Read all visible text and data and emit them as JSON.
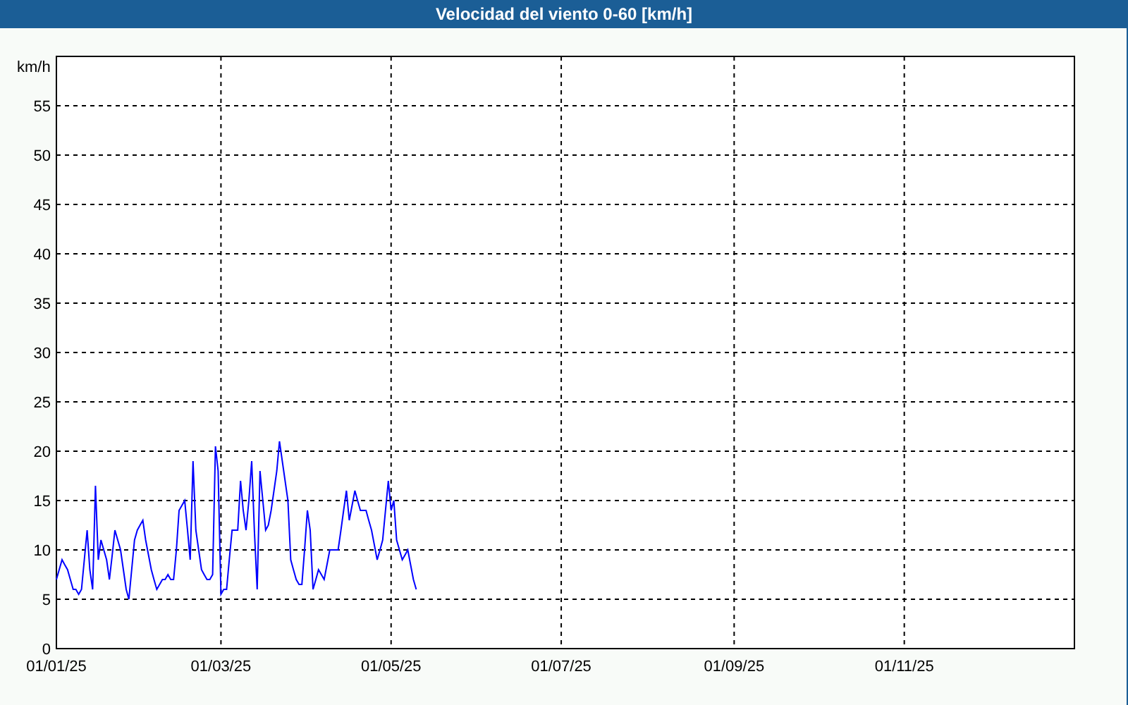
{
  "window": {
    "title": "Velocidad del viento 0-60 [km/h]"
  },
  "chart": {
    "chart_data": {
      "type": "line",
      "ylabel": "km/h",
      "grid": true,
      "ylim": [
        0,
        60
      ],
      "yticks": [
        0,
        5,
        10,
        15,
        20,
        25,
        30,
        35,
        40,
        45,
        50,
        55
      ],
      "categories": [
        "01/01/25",
        null,
        null,
        null,
        null,
        null,
        null,
        null,
        null,
        null,
        null,
        null,
        null,
        null,
        null,
        null,
        null,
        null,
        null,
        null,
        null,
        null,
        null,
        null,
        null,
        null,
        null,
        null,
        null,
        null,
        null,
        null,
        null,
        null,
        null,
        null,
        null,
        null,
        null,
        null,
        null,
        null,
        null,
        null,
        null,
        null,
        null,
        null,
        null,
        null,
        null,
        null,
        null,
        null,
        null,
        null,
        null,
        null,
        null,
        "01/03/25",
        null,
        null,
        null,
        null,
        null,
        null,
        null,
        null,
        null,
        null,
        null,
        null,
        null,
        null,
        null,
        null,
        null,
        null,
        null,
        null,
        null,
        null,
        null,
        null,
        null,
        null,
        null,
        null,
        null,
        null,
        null,
        null,
        null,
        null,
        null,
        null,
        null,
        null,
        null,
        null,
        null,
        null,
        null,
        null,
        null,
        null,
        null,
        null,
        null,
        null,
        null,
        null,
        null,
        null,
        null,
        null,
        null,
        null,
        null,
        null,
        "01/05/25",
        null,
        null,
        null,
        null,
        null,
        null,
        null,
        null,
        null,
        null,
        null,
        null,
        null,
        null,
        null,
        null,
        null,
        null,
        null,
        null,
        null,
        null,
        null,
        null,
        null,
        null,
        null,
        null,
        null,
        null,
        null,
        null,
        null,
        null,
        null,
        null,
        null,
        null,
        null,
        null,
        null,
        null,
        null,
        null,
        null,
        null,
        null,
        null,
        null,
        null,
        null,
        null,
        null,
        null,
        null,
        null,
        null,
        null,
        null,
        null,
        "01/07/25",
        null,
        null,
        null,
        null,
        null,
        null,
        null,
        null,
        null,
        null,
        null,
        null,
        null,
        null,
        null,
        null,
        null,
        null,
        null,
        null,
        null,
        null,
        null,
        null,
        null,
        null,
        null,
        null,
        null,
        null,
        null,
        null,
        null,
        null,
        null,
        null,
        null,
        null,
        null,
        null,
        null,
        null,
        null,
        null,
        null,
        null,
        null,
        null,
        null,
        null,
        null,
        null,
        null,
        null,
        null,
        null,
        null,
        null,
        null,
        null,
        null,
        "01/09/25",
        null,
        null,
        null,
        null,
        null,
        null,
        null,
        null,
        null,
        null,
        null,
        null,
        null,
        null,
        null,
        null,
        null,
        null,
        null,
        null,
        null,
        null,
        null,
        null,
        null,
        null,
        null,
        null,
        null,
        null,
        null,
        null,
        null,
        null,
        null,
        null,
        null,
        null,
        null,
        null,
        null,
        null,
        null,
        null,
        null,
        null,
        null,
        null,
        null,
        null,
        null,
        null,
        null,
        null,
        null,
        null,
        null,
        null,
        null,
        null,
        "01/11/25"
      ],
      "series": [
        {
          "color": "#0000ff",
          "values": [
            7,
            8,
            9,
            8.5,
            8,
            7,
            6,
            6,
            5.5,
            6,
            9,
            12,
            8,
            6,
            16.5,
            9,
            11,
            10,
            9,
            7,
            9.5,
            12,
            11,
            10,
            8,
            6,
            5,
            8,
            11,
            12,
            12.5,
            13,
            11,
            9.5,
            8,
            7,
            6,
            6.5,
            7,
            7,
            7.5,
            7,
            7,
            10,
            14,
            14.5,
            15,
            12,
            9,
            19,
            12,
            10,
            8,
            7.5,
            7,
            7,
            7.5,
            20.5,
            18,
            5.5,
            6,
            6,
            9,
            12,
            12,
            12,
            17,
            14,
            12,
            15,
            19,
            12,
            6,
            18,
            15,
            12,
            12.5,
            14,
            16,
            18,
            21,
            19,
            17,
            15,
            9,
            8,
            7,
            6.5,
            6.5,
            10,
            14,
            12,
            6,
            7,
            8,
            7.5,
            7,
            8.5,
            10,
            10,
            10,
            10,
            12,
            14,
            16,
            13,
            14.5,
            16,
            15,
            14,
            14,
            14,
            13,
            12,
            10.5,
            9,
            10,
            11,
            14,
            17,
            14,
            15,
            11,
            10,
            9,
            9.5,
            10,
            8.5,
            7,
            6,
            null,
            null,
            null,
            null,
            null,
            null,
            null,
            null,
            null,
            null,
            null,
            null,
            null,
            null,
            null,
            null,
            null,
            null,
            null,
            null,
            null,
            null,
            null,
            null,
            null,
            null,
            null,
            null,
            null,
            null,
            null,
            null,
            null,
            null,
            null,
            null,
            null,
            null,
            null,
            null,
            null,
            null,
            null,
            null,
            null,
            null,
            null,
            null,
            null,
            null,
            null,
            null,
            null,
            null,
            null,
            null,
            null,
            null,
            null,
            null,
            null,
            null,
            null,
            null,
            null,
            null,
            null,
            null,
            null,
            null,
            null,
            null,
            null,
            null,
            null,
            null,
            null,
            null,
            null,
            null,
            null,
            null,
            null,
            null,
            null,
            null,
            null,
            null,
            null,
            null,
            null,
            null,
            null,
            null,
            null,
            null,
            null,
            null,
            null,
            null,
            null,
            null,
            null,
            null,
            null,
            null,
            null,
            null,
            null,
            null,
            null,
            null,
            null,
            null,
            null,
            null,
            null,
            null,
            null,
            null,
            null,
            null,
            null,
            null,
            null,
            null,
            null,
            null,
            null,
            null,
            null,
            null,
            null,
            null,
            null,
            null,
            null,
            null,
            null,
            null,
            null,
            null,
            null,
            null,
            null,
            null,
            null,
            null,
            null,
            null,
            null,
            null,
            null,
            null,
            null,
            null,
            null,
            null,
            null,
            null,
            null,
            null,
            null,
            null,
            null,
            null,
            null,
            null,
            null,
            null,
            null,
            null,
            null,
            null,
            null
          ]
        }
      ]
    }
  }
}
